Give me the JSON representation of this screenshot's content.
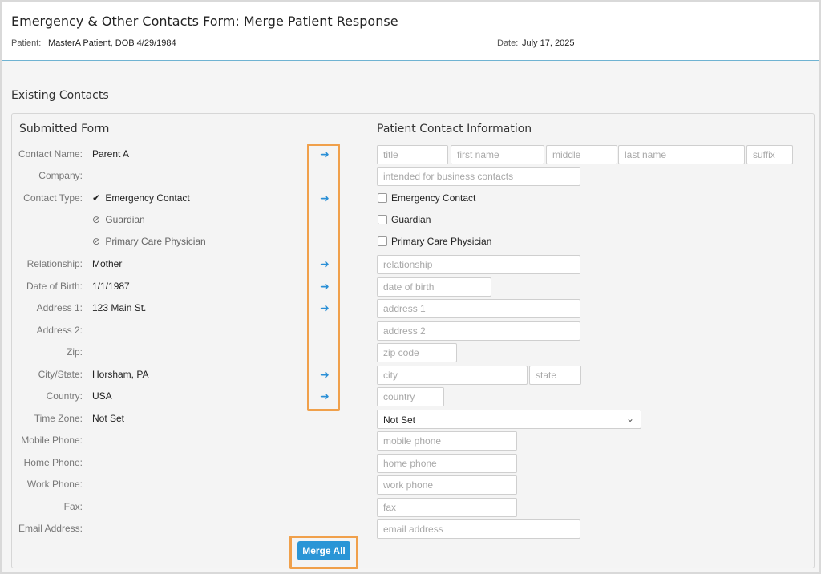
{
  "header": {
    "title": "Emergency & Other Contacts Form: Merge Patient Response",
    "patient_label": "Patient:",
    "patient_value": "MasterA Patient, DOB 4/29/1984",
    "date_label": "Date:",
    "date_value": "July 17, 2025"
  },
  "section_title": "Existing Contacts",
  "submitted_title": "Submitted Form",
  "patient_info_title": "Patient Contact Information",
  "colors": {
    "accent": "#2a95d6",
    "highlight": "#f0a04b",
    "header_rule": "#6fb3d2"
  },
  "rows": {
    "contact_name": {
      "label": "Contact Name:",
      "value": "Parent A"
    },
    "company": {
      "label": "Company:",
      "value": ""
    },
    "contact_type": {
      "label": "Contact Type:"
    },
    "relationship": {
      "label": "Relationship:",
      "value": "Mother"
    },
    "dob": {
      "label": "Date of Birth:",
      "value": "1/1/1987"
    },
    "address1": {
      "label": "Address 1:",
      "value": "123 Main St."
    },
    "address2": {
      "label": "Address 2:",
      "value": ""
    },
    "zip": {
      "label": "Zip:",
      "value": ""
    },
    "city_state": {
      "label": "City/State:",
      "value": "Horsham, PA"
    },
    "country": {
      "label": "Country:",
      "value": "USA"
    },
    "time_zone": {
      "label": "Time Zone:",
      "value": "Not Set"
    },
    "mobile": {
      "label": "Mobile Phone:",
      "value": ""
    },
    "home": {
      "label": "Home Phone:",
      "value": ""
    },
    "work": {
      "label": "Work Phone:",
      "value": ""
    },
    "fax": {
      "label": "Fax:",
      "value": ""
    },
    "email": {
      "label": "Email Address:",
      "value": ""
    }
  },
  "contact_types_submitted": [
    {
      "name": "Emergency Contact",
      "icon": "checkmark-icon",
      "glyph": "✔"
    },
    {
      "name": "Guardian",
      "icon": "not-selected-icon",
      "glyph": "⊘"
    },
    {
      "name": "Primary Care Physician",
      "icon": "not-selected-icon",
      "glyph": "⊘"
    }
  ],
  "contact_types_patient": [
    "Emergency Contact",
    "Guardian",
    "Primary Care Physician"
  ],
  "placeholders": {
    "title": "title",
    "first_name": "first name",
    "middle": "middle",
    "last_name": "last name",
    "suffix": "suffix",
    "company": "intended for business contacts",
    "relationship": "relationship",
    "dob": "date of birth",
    "address1": "address 1",
    "address2": "address 2",
    "zip": "zip code",
    "city": "city",
    "state": "state",
    "country": "country",
    "mobile": "mobile phone",
    "home": "home phone",
    "work": "work phone",
    "fax": "fax",
    "email": "email address"
  },
  "time_zone_select": "Not Set",
  "arrow_glyph": "➜",
  "merge_all_label": "Merge All"
}
